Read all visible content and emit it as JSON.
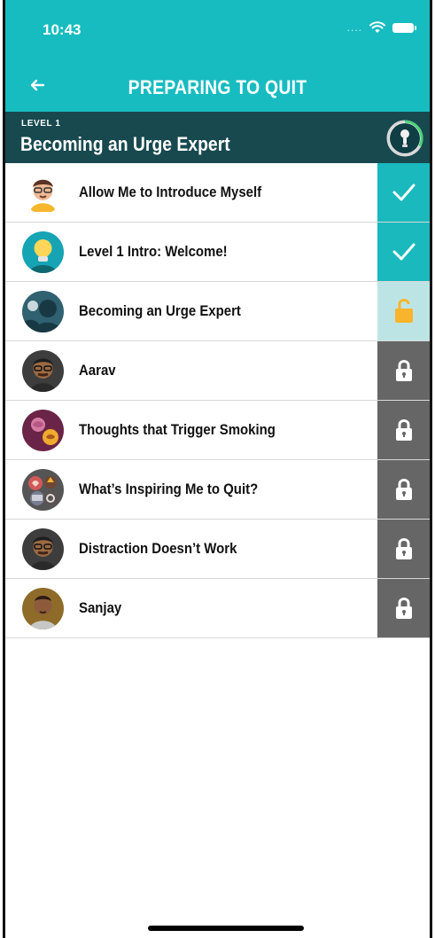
{
  "status_bar": {
    "time": "10:43",
    "signal": "....",
    "icons": [
      "wifi-icon",
      "battery-icon"
    ]
  },
  "header": {
    "title": "PREPARING TO QUIT",
    "back_icon": "back-arrow-icon"
  },
  "level": {
    "label": "LEVEL 1",
    "title": "Becoming an Urge Expert",
    "progress": 0.33
  },
  "colors": {
    "teal": "#17bcc1",
    "dark_teal": "#17494f",
    "done": "#19b9bd",
    "current": "#bde4e5",
    "locked": "#666666",
    "accent": "#f7b42c"
  },
  "lessons": [
    {
      "title": "Allow Me to Introduce Myself",
      "status": "completed",
      "avatar": "narrator-avatar"
    },
    {
      "title": "Level 1 Intro: Welcome!",
      "status": "completed",
      "avatar": "lightbulb-avatar"
    },
    {
      "title": "Becoming an Urge Expert",
      "status": "current",
      "avatar": "silhouette-avatar"
    },
    {
      "title": "Aarav",
      "status": "locked",
      "avatar": "man-glasses-avatar"
    },
    {
      "title": "Thoughts that Trigger Smoking",
      "status": "locked",
      "avatar": "brain-avatar"
    },
    {
      "title": "What’s Inspiring Me to Quit?",
      "status": "locked",
      "avatar": "collage-avatar"
    },
    {
      "title": "Distraction Doesn’t Work",
      "status": "locked",
      "avatar": "man-glasses-avatar"
    },
    {
      "title": "Sanjay",
      "status": "locked",
      "avatar": "man-avatar"
    }
  ]
}
